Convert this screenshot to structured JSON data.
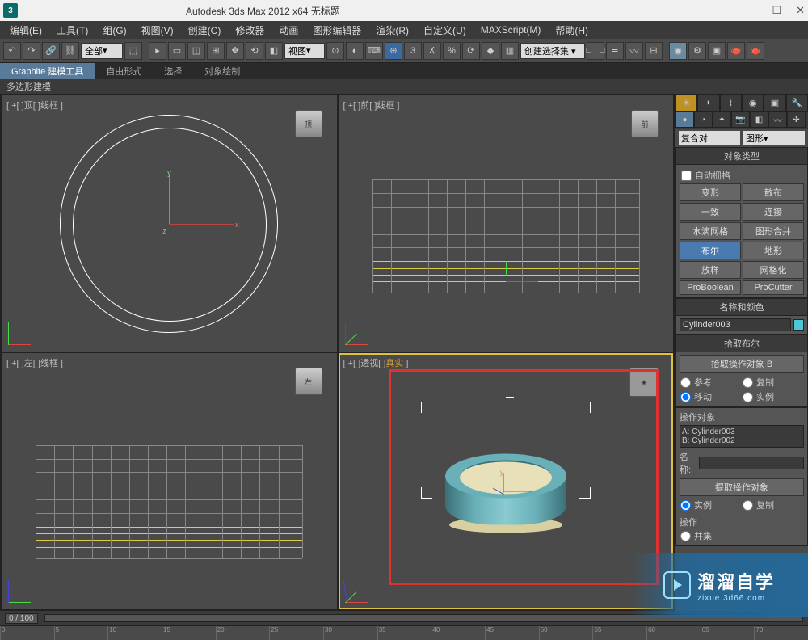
{
  "title": "Autodesk 3ds Max  2012 x64        无标题",
  "menu": [
    "编辑(E)",
    "工具(T)",
    "组(G)",
    "视图(V)",
    "创建(C)",
    "修改器",
    "动画",
    "图形编辑器",
    "渲染(R)",
    "自定义(U)",
    "MAXScript(M)",
    "帮助(H)"
  ],
  "toolbar": {
    "selset": "全部",
    "viewdrop": "视图"
  },
  "ribbon": {
    "tabs": [
      "Graphite 建模工具",
      "自由形式",
      "选择",
      "对象绘制"
    ],
    "sub": "多边形建模"
  },
  "viewports": {
    "top": "[ +[ ]顶[ ]线框 ]",
    "front": "[ +[ ]前[ ]线框 ]",
    "left": "[ +[ ]左[ ]线框 ]",
    "persp_prefix": "[ +[ ]透视[ ]",
    "persp_real": "真实",
    "persp_suffix": " ]",
    "cube_top": "顶",
    "cube_front": "前",
    "cube_left": "左"
  },
  "panel": {
    "category1": "复合对",
    "category2": "图形",
    "sec_objtype": "对象类型",
    "autogrid": "自动栅格",
    "buttons": [
      "变形",
      "散布",
      "一致",
      "连接",
      "水滴网格",
      "图形合并",
      "布尔",
      "地形",
      "放样",
      "网格化",
      "ProBoolean",
      "ProCutter"
    ],
    "sec_namecolor": "名称和颜色",
    "objname": "Cylinder003",
    "sec_pickbool": "拾取布尔",
    "pick_btn": "拾取操作对象 B",
    "radios1": [
      "参考",
      "复制",
      "移动",
      "实例"
    ],
    "sec_operand": "操作对象",
    "operands": [
      "A: Cylinder003",
      "B: Cylinder002"
    ],
    "name_label": "名称:",
    "extract_btn": "提取操作对象",
    "radios2": [
      "实例",
      "复制"
    ],
    "sec_op": "操作",
    "op_union": "并集"
  },
  "slider": {
    "frame": "0 / 100"
  },
  "timeline": {
    "ticks": [
      "0",
      "5",
      "10",
      "15",
      "20",
      "25",
      "30",
      "35",
      "40",
      "45",
      "50",
      "55",
      "60",
      "65",
      "70"
    ]
  },
  "watermark": {
    "main": "溜溜自学",
    "sub": "zixue.3d66.com"
  }
}
